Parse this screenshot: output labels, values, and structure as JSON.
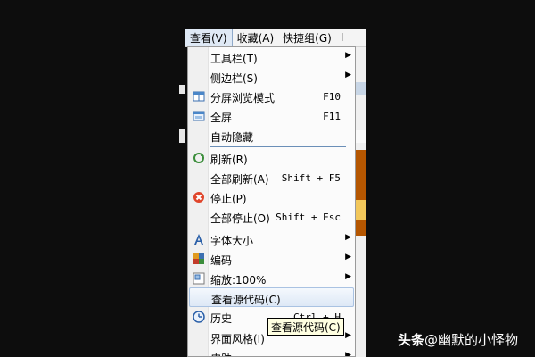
{
  "menubar": {
    "items": [
      {
        "label": "查看(V)"
      },
      {
        "label": "收藏(A)"
      },
      {
        "label": "快捷组(G)"
      },
      {
        "label": "I"
      }
    ]
  },
  "menu": {
    "items": [
      {
        "label": "工具栏(T)",
        "shortcut": "",
        "submenu": true,
        "icon": ""
      },
      {
        "label": "侧边栏(S)",
        "shortcut": "",
        "submenu": true,
        "icon": ""
      },
      {
        "label": "分屏浏览模式",
        "shortcut": "F10",
        "submenu": false,
        "icon": "split-view-icon"
      },
      {
        "label": "全屏",
        "shortcut": "F11",
        "submenu": false,
        "icon": "fullscreen-icon"
      },
      {
        "label": "自动隐藏",
        "shortcut": "",
        "submenu": false,
        "icon": ""
      },
      {
        "label": "刷新(R)",
        "shortcut": "",
        "submenu": false,
        "icon": "refresh-icon"
      },
      {
        "label": "全部刷新(A)",
        "shortcut": "Shift + F5",
        "submenu": false,
        "icon": ""
      },
      {
        "label": "停止(P)",
        "shortcut": "",
        "submenu": false,
        "icon": "stop-icon"
      },
      {
        "label": "全部停止(O)",
        "shortcut": "Shift + Esc",
        "submenu": false,
        "icon": ""
      },
      {
        "label": "字体大小",
        "shortcut": "",
        "submenu": true,
        "icon": "font-size-icon"
      },
      {
        "label": "编码",
        "shortcut": "",
        "submenu": true,
        "icon": "encoding-icon"
      },
      {
        "label": "缩放:100%",
        "shortcut": "",
        "submenu": true,
        "icon": "zoom-icon"
      },
      {
        "label": "查看源代码(C)",
        "shortcut": "",
        "submenu": false,
        "icon": ""
      },
      {
        "label": "历史",
        "shortcut": "Ctrl + H",
        "submenu": false,
        "icon": "history-icon"
      },
      {
        "label": "界面风格(I)",
        "shortcut": "",
        "submenu": true,
        "icon": ""
      },
      {
        "label": "皮肤",
        "shortcut": "",
        "submenu": true,
        "icon": ""
      }
    ]
  },
  "tooltip": {
    "text": "查看源代码(C)"
  },
  "watermark": {
    "brand": "头条",
    "handle": "@幽默的小怪物"
  },
  "colors": {
    "highlight_border": "#a9c2e2",
    "separator": "#6b8fb8",
    "accent_orange": "#b55600"
  }
}
